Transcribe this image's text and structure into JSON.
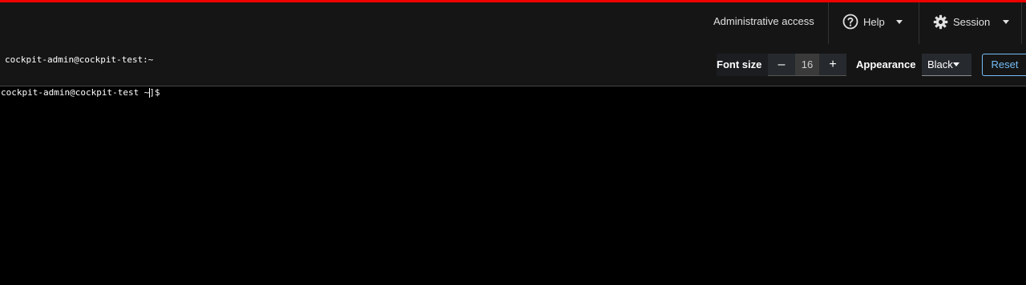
{
  "colors": {
    "accent": "#ee0000",
    "header_bg": "#151515",
    "terminal_bg": "#000000",
    "link_blue": "#73bcf7"
  },
  "header": {
    "admin_access": "Administrative access",
    "help_label": "Help",
    "help_icon": "question-circle-icon",
    "session_label": "Session",
    "session_icon": "gear-icon"
  },
  "toolbar": {
    "title": "cockpit-admin@cockpit-test:~",
    "font_size_label": "Font size",
    "decrease_label": "–",
    "font_size_value": "16",
    "increase_label": "+",
    "appearance_label": "Appearance",
    "appearance_value": "Black",
    "reset_label": "Reset"
  },
  "terminal": {
    "prompt_line": "cockpit-admin@cockpit-test ~]$"
  }
}
